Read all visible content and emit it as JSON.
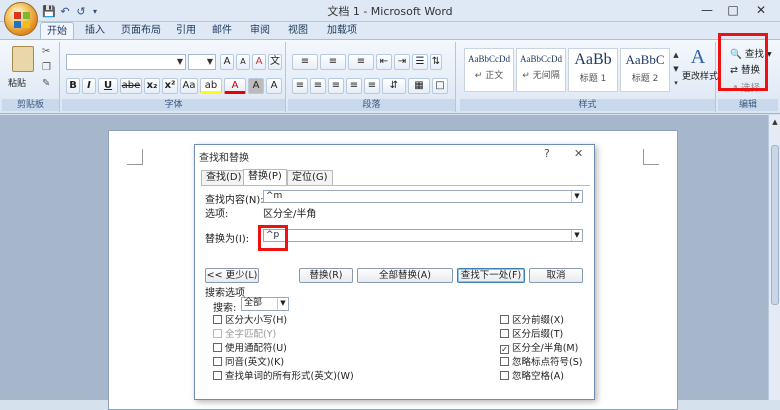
{
  "window": {
    "title": "文档 1 - Microsoft Word",
    "quick_access": [
      "save-icon",
      "undo-icon",
      "redo-icon",
      "customize-icon"
    ]
  },
  "tabs": [
    "开始",
    "插入",
    "页面布局",
    "引用",
    "邮件",
    "审阅",
    "视图",
    "加载项"
  ],
  "ribbon": {
    "clipboard": {
      "label": "剪贴板",
      "paste": "粘贴"
    },
    "font": {
      "label": "字体",
      "bold": "B",
      "italic": "I",
      "underline": "U",
      "strike": "abe",
      "subscript": "x₂",
      "superscript": "x²",
      "grow": "A",
      "shrink": "A",
      "clear": "A",
      "highlight": "ab",
      "fontcolor": "A",
      "charshade": "A"
    },
    "paragraph": {
      "label": "段落"
    },
    "styles": {
      "label": "样式",
      "items": [
        {
          "preview": "AaBbCcDd",
          "name": "↵ 正文"
        },
        {
          "preview": "AaBbCcDd",
          "name": "↵ 无间隔"
        },
        {
          "preview": "AaBb",
          "name": "标题 1"
        },
        {
          "preview": "AaBbC",
          "name": "标题 2"
        }
      ],
      "change": "更改样式"
    },
    "editing": {
      "label": "编辑",
      "find": "查找",
      "replace": "替换",
      "select": "选择"
    }
  },
  "dialog": {
    "title": "查找和替换",
    "help": "?",
    "close": "✕",
    "tabs": [
      "查找(D)",
      "替换(P)",
      "定位(G)"
    ],
    "find_label": "查找内容(N):",
    "find_value": "^m",
    "options_label": "选项:",
    "options_value": "区分全/半角",
    "replace_label": "替换为(I):",
    "replace_value": "^p",
    "buttons": {
      "less": "<< 更少(L)",
      "replace": "替换(R)",
      "replace_all": "全部替换(A)",
      "find_next": "查找下一处(F)",
      "cancel": "取消"
    },
    "search_options_label": "搜索选项",
    "search_label": "搜索:",
    "search_value": "全部",
    "left_checks": [
      {
        "label": "区分大小写(H)",
        "checked": false,
        "disabled": false
      },
      {
        "label": "全字匹配(Y)",
        "checked": false,
        "disabled": true
      },
      {
        "label": "使用通配符(U)",
        "checked": false,
        "disabled": false
      },
      {
        "label": "同音(英文)(K)",
        "checked": false,
        "disabled": false
      },
      {
        "label": "查找单词的所有形式(英文)(W)",
        "checked": false,
        "disabled": false
      }
    ],
    "right_checks": [
      {
        "label": "区分前缀(X)",
        "checked": false,
        "disabled": false
      },
      {
        "label": "区分后缀(T)",
        "checked": false,
        "disabled": false
      },
      {
        "label": "区分全/半角(M)",
        "checked": true,
        "disabled": false
      },
      {
        "label": "忽略标点符号(S)",
        "checked": false,
        "disabled": false
      },
      {
        "label": "忽略空格(A)",
        "checked": false,
        "disabled": false
      }
    ]
  },
  "colors": {
    "highlight_red": "#e11111",
    "ribbon_blue": "#dbe6f3"
  }
}
